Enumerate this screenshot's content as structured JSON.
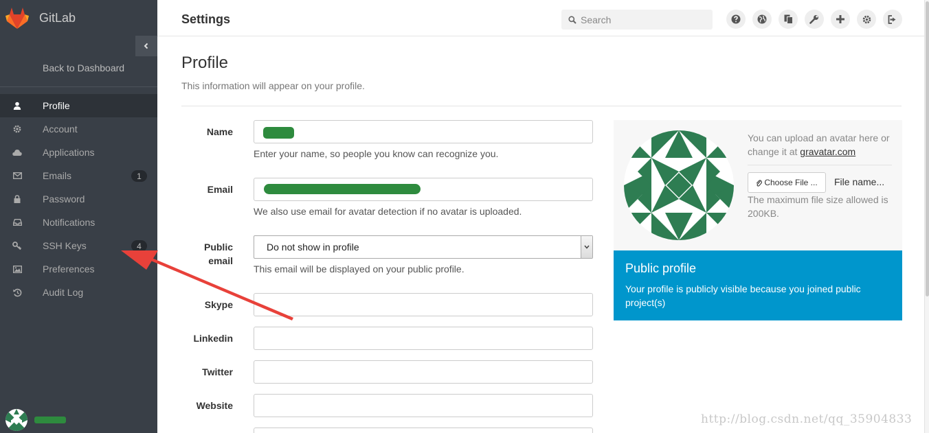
{
  "brand": {
    "name": "GitLab"
  },
  "sidebar": {
    "back_label": "Back to Dashboard",
    "items": [
      {
        "label": "Profile",
        "icon": "user-icon",
        "active": true
      },
      {
        "label": "Account",
        "icon": "gear-icon"
      },
      {
        "label": "Applications",
        "icon": "cloud-icon"
      },
      {
        "label": "Emails",
        "icon": "envelope-icon",
        "badge": "1"
      },
      {
        "label": "Password",
        "icon": "lock-icon"
      },
      {
        "label": "Notifications",
        "icon": "inbox-icon"
      },
      {
        "label": "SSH Keys",
        "icon": "key-icon",
        "badge": "4"
      },
      {
        "label": "Preferences",
        "icon": "image-icon"
      },
      {
        "label": "Audit Log",
        "icon": "history-icon"
      }
    ]
  },
  "header": {
    "title": "Settings",
    "search_placeholder": "Search",
    "icons": [
      "question-icon",
      "globe-icon",
      "copy-icon",
      "wrench-icon",
      "plus-icon",
      "gear-icon",
      "sign-out-icon"
    ]
  },
  "page": {
    "title": "Profile",
    "description": "This information will appear on your profile."
  },
  "form": {
    "name": {
      "label": "Name",
      "help": "Enter your name, so people you know can recognize you."
    },
    "email": {
      "label": "Email",
      "help": "We also use email for avatar detection if no avatar is uploaded."
    },
    "public_email": {
      "label_line1": "Public",
      "label_line2": "email",
      "value": "Do not show in profile",
      "help": "This email will be displayed on your public profile."
    },
    "skype": {
      "label": "Skype"
    },
    "linkedin": {
      "label": "Linkedin"
    },
    "twitter": {
      "label": "Twitter"
    },
    "website": {
      "label": "Website"
    }
  },
  "avatar": {
    "text_prefix": "You can upload an avatar here or change it at",
    "link": "gravatar.com",
    "choose_label": "Choose File ...",
    "file_name": "File name...",
    "max_size": "The maximum file size allowed is 200KB."
  },
  "public_profile": {
    "title": "Public profile",
    "text": "Your profile is publicly visible because you joined public project(s)"
  },
  "watermark": "http://blog.csdn.net/qq_35904833",
  "colors": {
    "sidebar": "#393f47",
    "accent_blue": "#0096cc",
    "avatar_green": "#2e7d52",
    "arrow_red": "#e8413a"
  }
}
